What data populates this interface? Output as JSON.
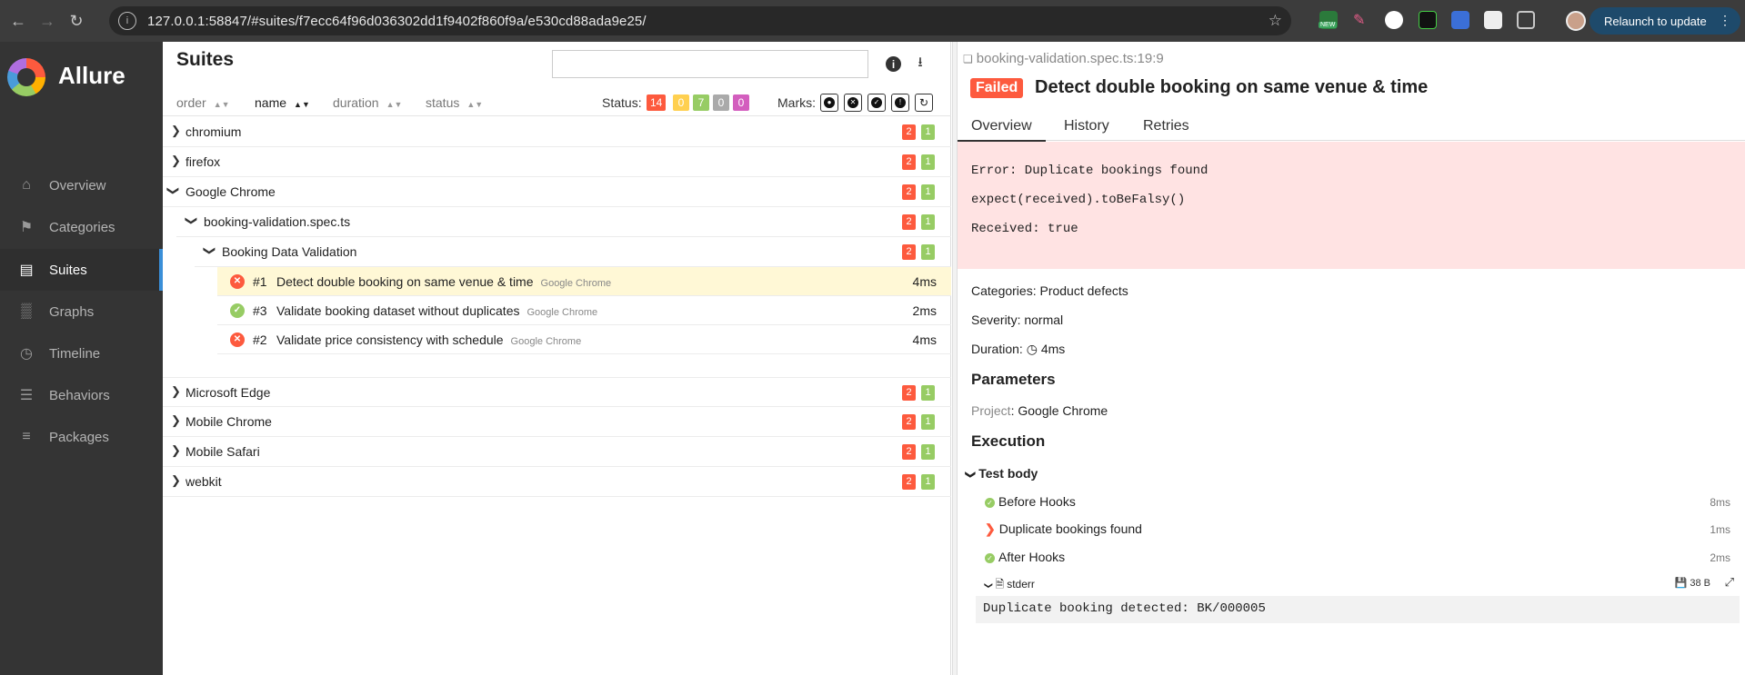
{
  "browser": {
    "url": "127.0.0.1:58847/#suites/f7ecc64f96d036302dd1f9402f860f9a/e530cd88ada9e25/",
    "relaunch_label": "Relaunch to update",
    "new_badge": "NEW"
  },
  "sidebar": {
    "brand": "Allure",
    "items": [
      {
        "label": "Overview",
        "icon": "home-icon"
      },
      {
        "label": "Categories",
        "icon": "flag-icon"
      },
      {
        "label": "Suites",
        "icon": "briefcase-icon"
      },
      {
        "label": "Graphs",
        "icon": "bar-chart-icon"
      },
      {
        "label": "Timeline",
        "icon": "clock-icon"
      },
      {
        "label": "Behaviors",
        "icon": "list-icon"
      },
      {
        "label": "Packages",
        "icon": "menu-icon"
      }
    ]
  },
  "suites": {
    "title": "Suites",
    "search_value": "",
    "sort": [
      "order",
      "name",
      "duration",
      "status"
    ],
    "status_label": "Status:",
    "status_counts": {
      "failed": "14",
      "broken": "0",
      "passed": "7",
      "skipped": "0",
      "unknown": "0"
    },
    "marks_label": "Marks:",
    "rows_top": [
      {
        "label": "chromium",
        "failed": "2",
        "passed": "1"
      },
      {
        "label": "firefox",
        "failed": "2",
        "passed": "1"
      },
      {
        "label": "Google Chrome",
        "failed": "2",
        "passed": "1"
      },
      {
        "label": "booking-validation.spec.ts",
        "failed": "2",
        "passed": "1"
      },
      {
        "label": "Booking Data Validation",
        "failed": "2",
        "passed": "1"
      }
    ],
    "tests": [
      {
        "num": "#1",
        "name": "Detect double booking on same venue & time",
        "tag": "Google Chrome",
        "duration": "4ms",
        "status": "failed"
      },
      {
        "num": "#3",
        "name": "Validate booking dataset without duplicates",
        "tag": "Google Chrome",
        "duration": "2ms",
        "status": "passed"
      },
      {
        "num": "#2",
        "name": "Validate price consistency with schedule",
        "tag": "Google Chrome",
        "duration": "4ms",
        "status": "failed"
      }
    ],
    "rows_bottom": [
      {
        "label": "Microsoft Edge",
        "failed": "2",
        "passed": "1"
      },
      {
        "label": "Mobile Chrome",
        "failed": "2",
        "passed": "1"
      },
      {
        "label": "Mobile Safari",
        "failed": "2",
        "passed": "1"
      },
      {
        "label": "webkit",
        "failed": "2",
        "passed": "1"
      }
    ]
  },
  "detail": {
    "path": "booking-validation.spec.ts:19:9",
    "badge": "Failed",
    "title": "Detect double booking on same venue & time",
    "tabs": [
      "Overview",
      "History",
      "Retries"
    ],
    "error_lines": [
      "Error: Duplicate bookings found",
      "expect(received).toBeFalsy()",
      "Received: true"
    ],
    "categories": "Categories: Product defects",
    "severity": "Severity: normal",
    "duration_label": "Duration:",
    "duration_value": "4ms",
    "parameters_heading": "Parameters",
    "param_key": "Project",
    "param_value": ": Google Chrome",
    "execution_heading": "Execution",
    "test_body_label": "Test body",
    "steps": [
      {
        "label": "Before Hooks",
        "duration": "8ms",
        "status": "passed"
      },
      {
        "label": "Duplicate bookings found",
        "duration": "1ms",
        "status": "failed"
      },
      {
        "label": "After Hooks",
        "duration": "2ms",
        "status": "passed"
      }
    ],
    "attachment_name": "stderr",
    "attachment_size": "38 B",
    "stderr_text": "Duplicate booking detected: BK/000005"
  },
  "colors": {
    "failed": "#fd5a3e",
    "broken": "#ffd050",
    "passed": "#97cc64",
    "skipped": "#aaaaaa",
    "unknown": "#d35ebe",
    "accent": "#3a8fd8"
  }
}
